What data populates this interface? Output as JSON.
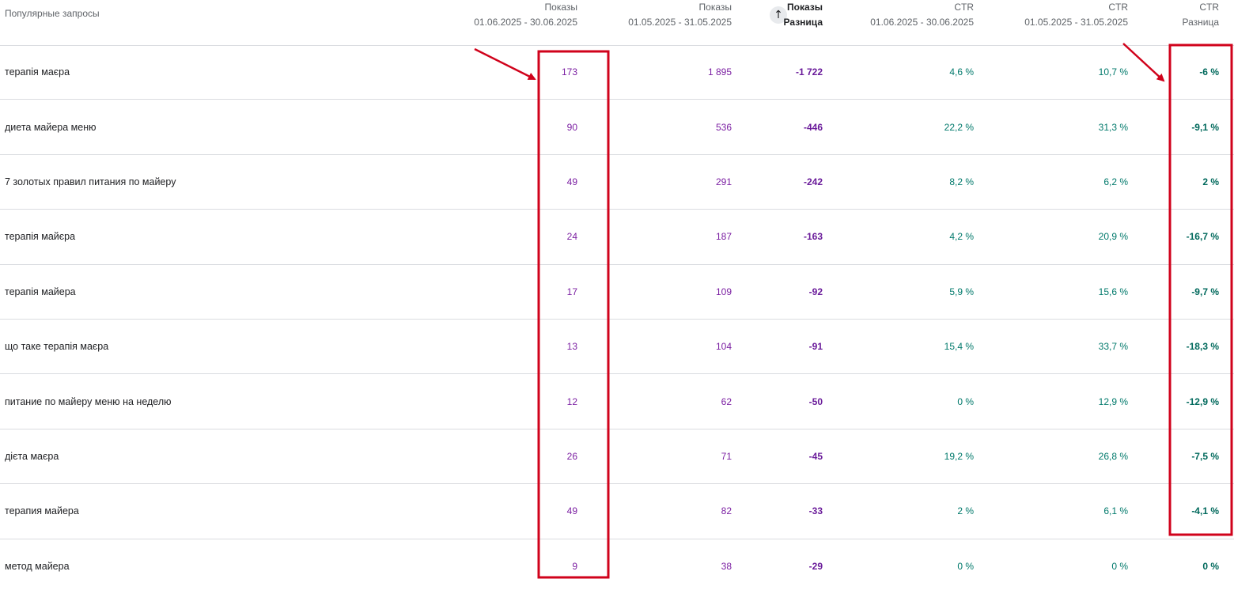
{
  "header": {
    "query_label": "Популярные запросы",
    "col1": {
      "metric": "Показы",
      "period": "01.06.2025 - 30.06.2025"
    },
    "col2": {
      "metric": "Показы",
      "period": "01.05.2025 - 31.05.2025"
    },
    "col3": {
      "metric": "Показы",
      "period": "Разница"
    },
    "col4": {
      "metric": "CTR",
      "period": "01.06.2025 - 30.06.2025"
    },
    "col5": {
      "metric": "CTR",
      "period": "01.05.2025 - 31.05.2025"
    },
    "col6": {
      "metric": "CTR",
      "period": "Разница"
    },
    "sort_icon": "arrow-up-icon"
  },
  "rows": [
    {
      "query": "терапія маєра",
      "impr_cur": "173",
      "impr_prev": "1 895",
      "impr_diff": "-1 722",
      "ctr_cur": "4,6 %",
      "ctr_prev": "10,7 %",
      "ctr_diff": "-6 %"
    },
    {
      "query": "диета майера меню",
      "impr_cur": "90",
      "impr_prev": "536",
      "impr_diff": "-446",
      "ctr_cur": "22,2 %",
      "ctr_prev": "31,3 %",
      "ctr_diff": "-9,1 %"
    },
    {
      "query": "7 золотых правил питания по майеру",
      "impr_cur": "49",
      "impr_prev": "291",
      "impr_diff": "-242",
      "ctr_cur": "8,2 %",
      "ctr_prev": "6,2 %",
      "ctr_diff": "2 %"
    },
    {
      "query": "терапія майєра",
      "impr_cur": "24",
      "impr_prev": "187",
      "impr_diff": "-163",
      "ctr_cur": "4,2 %",
      "ctr_prev": "20,9 %",
      "ctr_diff": "-16,7 %"
    },
    {
      "query": "терапія майера",
      "impr_cur": "17",
      "impr_prev": "109",
      "impr_diff": "-92",
      "ctr_cur": "5,9 %",
      "ctr_prev": "15,6 %",
      "ctr_diff": "-9,7 %"
    },
    {
      "query": "що таке терапія маєра",
      "impr_cur": "13",
      "impr_prev": "104",
      "impr_diff": "-91",
      "ctr_cur": "15,4 %",
      "ctr_prev": "33,7 %",
      "ctr_diff": "-18,3 %"
    },
    {
      "query": "питание по майеру меню на неделю",
      "impr_cur": "12",
      "impr_prev": "62",
      "impr_diff": "-50",
      "ctr_cur": "0 %",
      "ctr_prev": "12,9 %",
      "ctr_diff": "-12,9 %"
    },
    {
      "query": "дієта маєра",
      "impr_cur": "26",
      "impr_prev": "71",
      "impr_diff": "-45",
      "ctr_cur": "19,2 %",
      "ctr_prev": "26,8 %",
      "ctr_diff": "-7,5 %"
    },
    {
      "query": "терапия майера",
      "impr_cur": "49",
      "impr_prev": "82",
      "impr_diff": "-33",
      "ctr_cur": "2 %",
      "ctr_prev": "6,1 %",
      "ctr_diff": "-4,1 %"
    },
    {
      "query": "метод майера",
      "impr_cur": "9",
      "impr_prev": "38",
      "impr_diff": "-29",
      "ctr_cur": "0 %",
      "ctr_prev": "0 %",
      "ctr_diff": "0 %"
    }
  ],
  "annotations": {
    "highlight_color": "#d0021b"
  }
}
